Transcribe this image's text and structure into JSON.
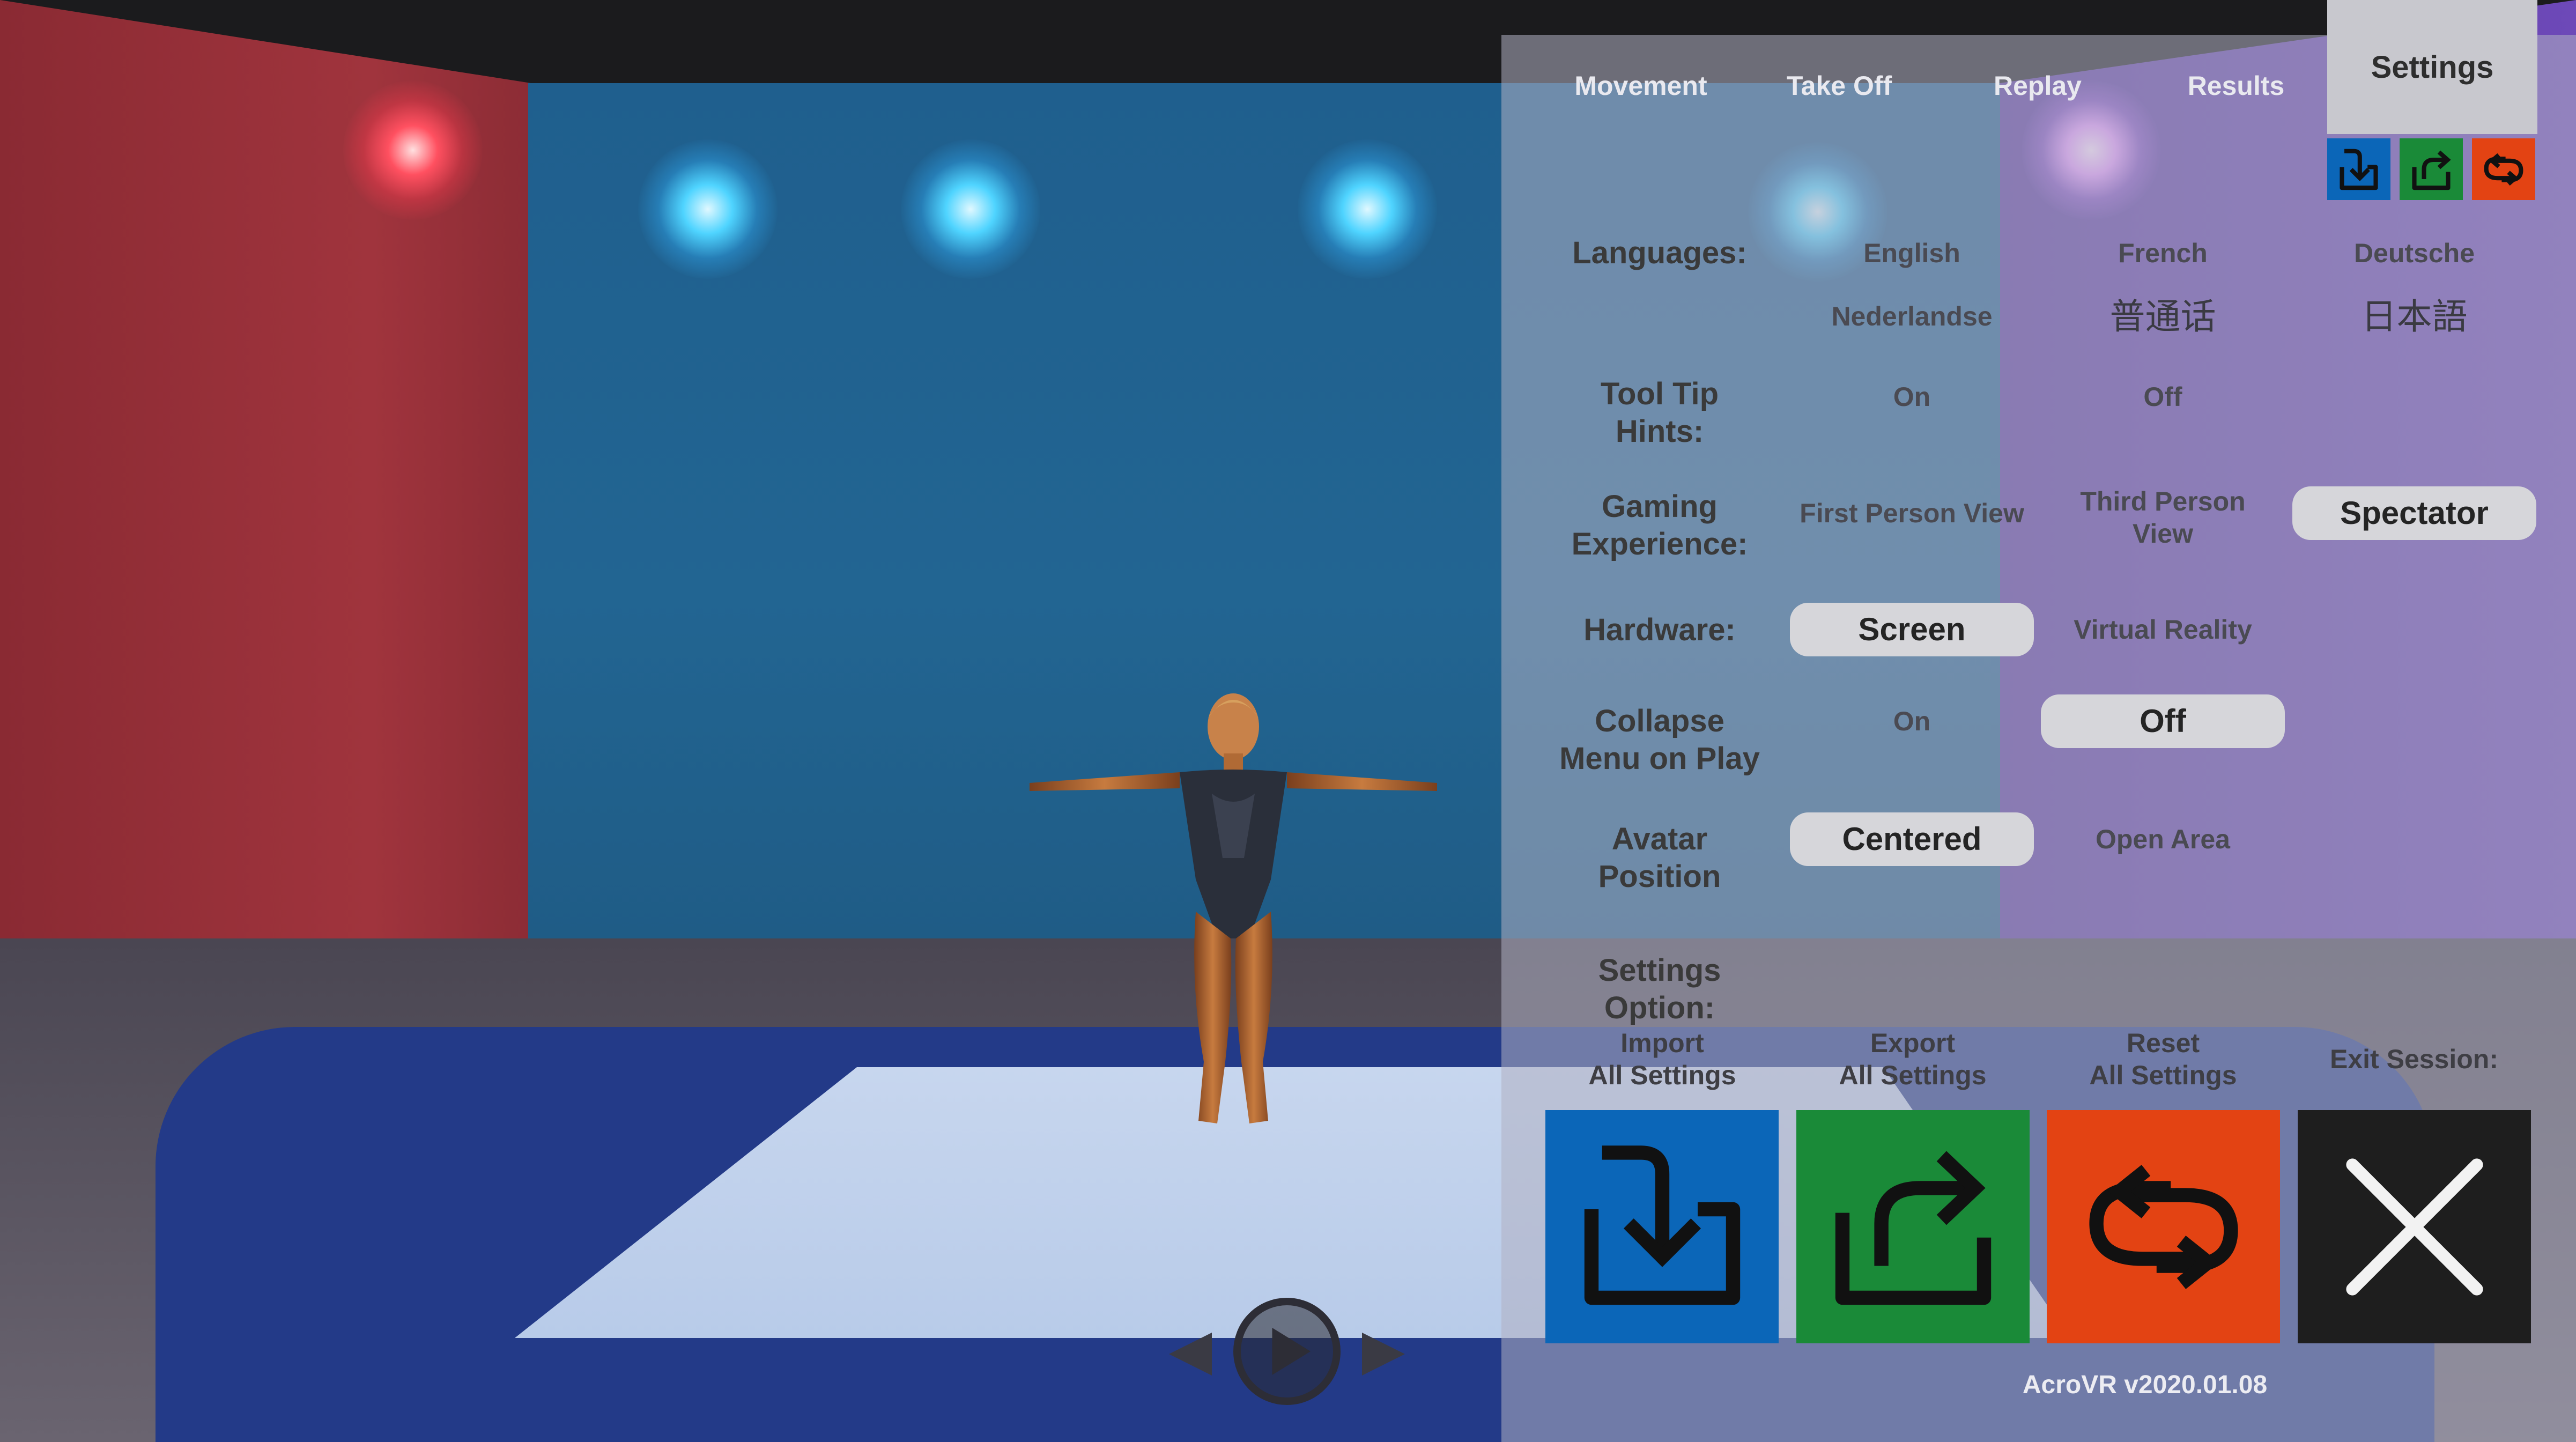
{
  "tabs": {
    "movement": "Movement",
    "take_off": "Take Off",
    "replay": "Replay",
    "results": "Results",
    "settings": "Settings"
  },
  "quick_icons": [
    "import-icon",
    "export-icon",
    "reset-icon"
  ],
  "settings": {
    "languages": {
      "label": "Languages:",
      "options": [
        "English",
        "French",
        "Deutsche",
        "Nederlandse",
        "普通话",
        "日本語"
      ]
    },
    "tool_tip_hints": {
      "label_line1": "Tool Tip",
      "label_line2": "Hints:",
      "on": "On",
      "off": "Off"
    },
    "gaming_experience": {
      "label_line1": "Gaming",
      "label_line2": "Experience:",
      "first_person": "First Person View",
      "third_person_line1": "Third Person",
      "third_person_line2": "View",
      "spectator": "Spectator",
      "selected": "Spectator"
    },
    "hardware": {
      "label": "Hardware:",
      "screen": "Screen",
      "vr": "Virtual Reality",
      "selected": "Screen"
    },
    "collapse_menu": {
      "label_line1": "Collapse",
      "label_line2": "Menu on Play",
      "on": "On",
      "off": "Off",
      "selected": "Off"
    },
    "avatar_position": {
      "label_line1": "Avatar",
      "label_line2": "Position",
      "centered": "Centered",
      "open_area": "Open Area",
      "selected": "Centered"
    },
    "settings_option": {
      "label_line1": "Settings",
      "label_line2": "Option:"
    }
  },
  "actions": {
    "import_line1": "Import",
    "import_line2": "All Settings",
    "export_line1": "Export",
    "export_line2": "All Settings",
    "reset_line1": "Reset",
    "reset_line2": "All Settings",
    "exit": "Exit Session:"
  },
  "version": "AcroVR v2020.01.08",
  "colors": {
    "import": "#0b66b8",
    "export": "#1a8a38",
    "reset": "#e34313",
    "exit": "#1e1e1e",
    "selected_option": "#d6d6da"
  }
}
